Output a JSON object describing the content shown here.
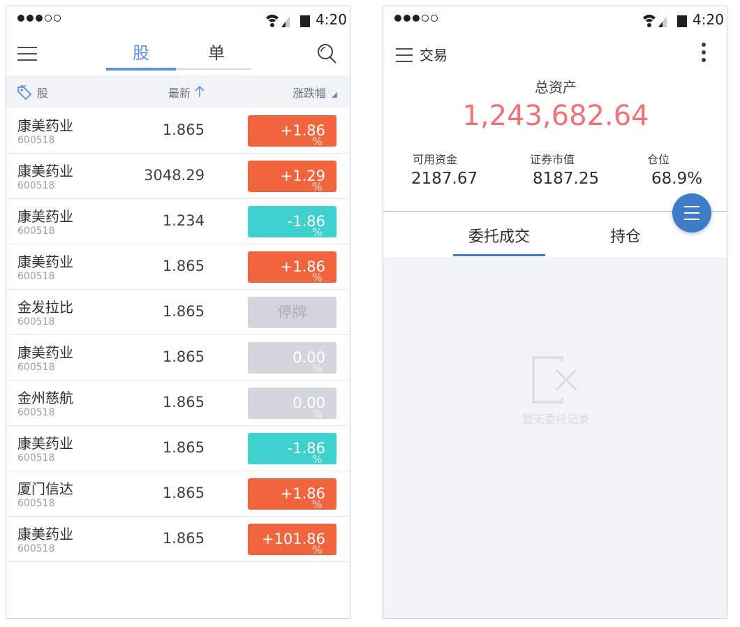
{
  "status": {
    "time": "4:20"
  },
  "left": {
    "tabs": [
      "股",
      "单"
    ],
    "header": {
      "col1": "股",
      "col2": "最新",
      "col3": "涨跌幅"
    },
    "rows": [
      {
        "name": "康美药业",
        "code": "600518",
        "price": "1.865",
        "change": "+1.86",
        "pct": "%",
        "trend": "up"
      },
      {
        "name": "康美药业",
        "code": "600518",
        "price": "3048.29",
        "change": "+1.29",
        "pct": "%",
        "trend": "up"
      },
      {
        "name": "康美药业",
        "code": "600518",
        "price": "1.234",
        "change": "-1.86",
        "pct": "%",
        "trend": "down"
      },
      {
        "name": "康美药业",
        "code": "600518",
        "price": "1.865",
        "change": "+1.86",
        "pct": "%",
        "trend": "up"
      },
      {
        "name": "金发拉比",
        "code": "600518",
        "price": "1.865",
        "change": "停牌",
        "pct": "",
        "trend": "halt"
      },
      {
        "name": "康美药业",
        "code": "600518",
        "price": "1.865",
        "change": "0.00",
        "pct": "%",
        "trend": "flat"
      },
      {
        "name": "金州慈航",
        "code": "600518",
        "price": "1.865",
        "change": "0.00",
        "pct": "%",
        "trend": "flat"
      },
      {
        "name": "康美药业",
        "code": "600518",
        "price": "1.865",
        "change": "-1.86",
        "pct": "%",
        "trend": "down"
      },
      {
        "name": "厦门信达",
        "code": "600518",
        "price": "1.865",
        "change": "+1.86",
        "pct": "%",
        "trend": "up"
      },
      {
        "name": "康美药业",
        "code": "600518",
        "price": "1.865",
        "change": "+101.86",
        "pct": "%",
        "trend": "up"
      }
    ]
  },
  "right": {
    "title": "交易",
    "total_assets_label": "总资产",
    "total_assets_value": "1,243,682.64",
    "stats": [
      {
        "label": "可用资金",
        "value": "2187.67"
      },
      {
        "label": "证券市值",
        "value": "8187.25"
      },
      {
        "label": "仓位",
        "value": "68.9%"
      }
    ],
    "tabs": [
      "委托成交",
      "持仓"
    ],
    "empty_text": "暂无委托记录"
  },
  "colors": {
    "accent": "#5b8fe8",
    "up": "#f0643e",
    "down": "#3ed1cf",
    "flat": "#d3d6dc",
    "asset": "#f07277",
    "fab": "#3e7cc8"
  }
}
